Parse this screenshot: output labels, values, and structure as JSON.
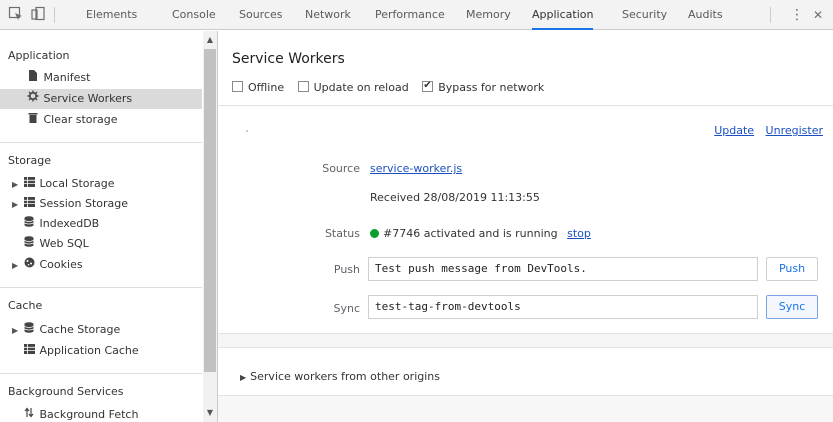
{
  "toolbar": {
    "tabs": [
      "Elements",
      "Console",
      "Sources",
      "Network",
      "Performance",
      "Memory",
      "Application",
      "Security",
      "Audits"
    ],
    "active_tab": "Application",
    "kebab": "⋮",
    "close": "✕"
  },
  "sidebar": {
    "application": {
      "header": "Application",
      "items": [
        "Manifest",
        "Service Workers",
        "Clear storage"
      ],
      "selected": "Service Workers"
    },
    "storage": {
      "header": "Storage",
      "items": [
        "Local Storage",
        "Session Storage",
        "IndexedDB",
        "Web SQL",
        "Cookies"
      ]
    },
    "cache": {
      "header": "Cache",
      "items": [
        "Cache Storage",
        "Application Cache"
      ]
    },
    "background": {
      "header": "Background Services",
      "items": [
        "Background Fetch"
      ]
    }
  },
  "main": {
    "title": "Service Workers",
    "options": [
      {
        "label": "Offline",
        "checked": false
      },
      {
        "label": "Update on reload",
        "checked": false
      },
      {
        "label": "Bypass for network",
        "checked": true
      }
    ],
    "links": {
      "update": "Update",
      "unregister": "Unregister"
    },
    "source_label": "Source",
    "source_file": "service-worker.js",
    "received": "Received 28/08/2019 11:13:55",
    "status_label": "Status",
    "status_text": "#7746 activated and is running",
    "status_color": "#0a9e2f",
    "stop_link": "stop",
    "push_label": "Push",
    "push_value": "Test push message from DevTools.",
    "push_button": "Push",
    "sync_label": "Sync",
    "sync_value": "test-tag-from-devtools",
    "sync_button": "Sync",
    "other_origins": "Service workers from other origins"
  }
}
